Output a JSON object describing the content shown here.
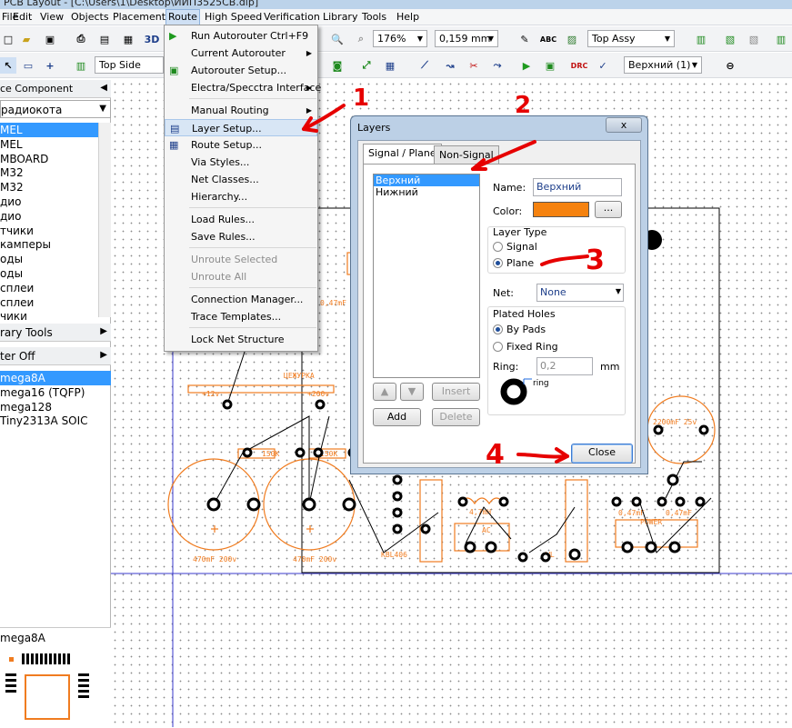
{
  "window": {
    "title": "PCB Layout - [C:\\Users\\1\\Desktop\\ИИП3525CB.dip]"
  },
  "menubar": [
    "File",
    "Edit",
    "View",
    "Objects",
    "Placement",
    "Route",
    "High Speed",
    "Verification",
    "Library",
    "Tools",
    "Help"
  ],
  "toolbar1": {
    "zoom": "176%",
    "grid": "0,159 mm",
    "view": "Top Assy"
  },
  "toolbar2": {
    "side": "Top Side",
    "layer": "Верхний (1)"
  },
  "left_panel": {
    "header1": "ce Component",
    "category": "радиокота",
    "library_items": [
      "MEL",
      "MEL",
      "MBOARD",
      "M32",
      "M32",
      "дио",
      "дио",
      "тчики",
      "камперы",
      "оды",
      "оды",
      "сплеи",
      "сплеи",
      "чики"
    ],
    "header2": "rary Tools",
    "header3": "ter Off",
    "components": [
      "mega8A",
      "mega16 (TQFP)",
      "mega128",
      "Tiny2313A SOIC"
    ],
    "preview_title": "mega8A"
  },
  "route_menu": {
    "items": [
      {
        "label": "Run Autorouter",
        "shortcut": "Ctrl+F9"
      },
      {
        "label": "Current Autorouter",
        "submenu": true
      },
      {
        "label": "Autorouter Setup..."
      },
      {
        "label": "Electra/Specctra Interface",
        "submenu": true
      },
      {
        "label": "Manual Routing",
        "submenu": true
      },
      {
        "label": "Layer Setup..."
      },
      {
        "label": "Route Setup..."
      },
      {
        "label": "Via Styles..."
      },
      {
        "label": "Net Classes..."
      },
      {
        "label": "Hierarchy..."
      },
      {
        "label": "Load Rules..."
      },
      {
        "label": "Save Rules..."
      },
      {
        "label": "Unroute Selected",
        "disabled": true
      },
      {
        "label": "Unroute All",
        "disabled": true
      },
      {
        "label": "Connection Manager..."
      },
      {
        "label": "Trace Templates..."
      },
      {
        "label": "Lock Net Structure"
      }
    ]
  },
  "layers_dialog": {
    "title": "Layers",
    "close_x": "x",
    "tabs": [
      "Signal / Plane",
      "Non-Signal"
    ],
    "layers": [
      "Верхний",
      "Нижний"
    ],
    "name_label": "Name:",
    "name_value": "Верхний",
    "color_label": "Color:",
    "color_value": "#f5820f",
    "color_btn": "...",
    "layer_type_label": "Layer Type",
    "signal_label": "Signal",
    "plane_label": "Plane",
    "net_label": "Net:",
    "net_value": "None",
    "plated_label": "Plated Holes",
    "by_pads": "By Pads",
    "fixed_ring": "Fixed Ring",
    "ring_label": "Ring:",
    "ring_value": "0,2",
    "ring_unit": "mm",
    "ring_preview": "ring",
    "insert": "Insert",
    "add": "Add",
    "delete": "Delete",
    "close": "Close"
  },
  "annotations": [
    "1",
    "2",
    "3",
    "4"
  ],
  "pcb": {
    "labels": [
      "470mF 200v",
      "470mF 200v",
      "150K",
      "150K",
      "+12v",
      "+200v",
      "KBL406",
      "2200mF 25v",
      "POWER",
      "0,47mF",
      "0,47mF",
      "ЦЕЖУРКА",
      "0,47mF",
      "AC",
      "4,7mH",
      "WL"
    ]
  },
  "colors": {
    "accent": "#3399ff",
    "copper": "#f07c20",
    "annotation": "#e60000"
  }
}
